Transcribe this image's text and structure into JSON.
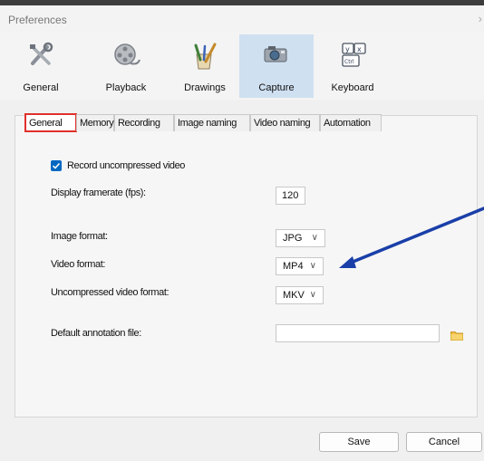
{
  "window": {
    "title": "Preferences",
    "close_glyph": "›"
  },
  "toolbar": {
    "items": [
      {
        "label": "General",
        "icon": "tools-icon"
      },
      {
        "label": "Playback",
        "icon": "film-reel-icon"
      },
      {
        "label": "Drawings",
        "icon": "paint-brush-icon"
      },
      {
        "label": "Capture",
        "icon": "camera-icon",
        "active": true
      },
      {
        "label": "Keyboard",
        "icon": "keyboard-icon"
      }
    ]
  },
  "tabs": [
    "General",
    "Memory",
    "Recording",
    "Image naming",
    "Video naming",
    "Automation"
  ],
  "selected_tab": "General",
  "general": {
    "record_uncompressed_label": "Record uncompressed video",
    "record_uncompressed_checked": true,
    "display_framerate_label": "Display framerate (fps):",
    "display_framerate_value": "120",
    "image_format_label": "Image format:",
    "image_format_value": "JPG",
    "video_format_label": "Video format:",
    "video_format_value": "MP4",
    "uncompressed_format_label": "Uncompressed video format:",
    "uncompressed_format_value": "MKV",
    "annotation_file_label": "Default annotation file:",
    "annotation_file_value": ""
  },
  "buttons": {
    "save": "Save",
    "cancel": "Cancel"
  },
  "colors": {
    "accent": "#0067c0",
    "active_tool": "#cfe0f1",
    "tab_highlight": "#e0302a",
    "annotation_arrow": "#1a3fa8"
  }
}
